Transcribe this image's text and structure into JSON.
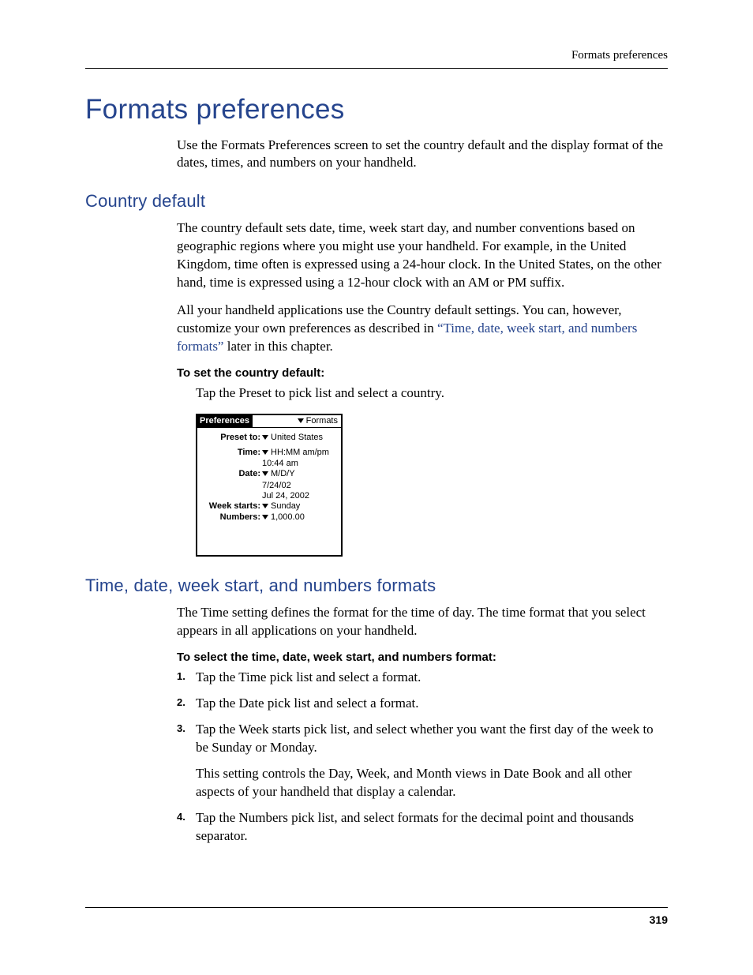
{
  "header": {
    "running": "Formats preferences"
  },
  "section": {
    "h1": "Formats preferences",
    "intro": "Use the Formats Preferences screen to set the country default and the display format of the dates, times, and numbers on your handheld."
  },
  "country": {
    "h2": "Country default",
    "p1": "The country default sets date, time, week start day, and number conventions based on geographic regions where you might use your handheld. For example, in the United Kingdom, time often is expressed using a 24-hour clock. In the United States, on the other hand, time is expressed using a 12-hour clock with an AM or PM suffix.",
    "p2_a": "All your handheld applications use the Country default settings. You can, however, customize your own preferences as described in ",
    "p2_link": "“Time, date, week start, and numbers formats”",
    "p2_b": " later in this chapter.",
    "task_heading": "To set the country default:",
    "task_step": "Tap the Preset to pick list and select a country."
  },
  "palm": {
    "title_tab": "Preferences",
    "title_menu": "Formats",
    "rows": {
      "preset_label": "Preset to:",
      "preset_value": "United States",
      "time_label": "Time:",
      "time_value": "HH:MM am/pm",
      "time_example": "10:44 am",
      "date_label": "Date:",
      "date_value": "M/D/Y",
      "date_example1": "7/24/02",
      "date_example2": "Jul 24, 2002",
      "week_label": "Week starts:",
      "week_value": "Sunday",
      "numbers_label": "Numbers:",
      "numbers_value": "1,000.00"
    }
  },
  "formats": {
    "h2": "Time, date, week start, and numbers formats",
    "intro": "The Time setting defines the format for the time of day. The time format that you select appears in all applications on your handheld.",
    "task_heading": "To select the time, date, week start, and numbers format:",
    "steps": {
      "s1_num": "1.",
      "s1": "Tap the Time pick list and select a format.",
      "s2_num": "2.",
      "s2": "Tap the Date pick list and select a format.",
      "s3_num": "3.",
      "s3": "Tap the Week starts pick list, and select whether you want the first day of the week to be Sunday or Monday.",
      "s3_note": "This setting controls the Day, Week, and Month views in Date Book and all other aspects of your handheld that display a calendar.",
      "s4_num": "4.",
      "s4": "Tap the Numbers pick list, and select formats for the decimal point and thousands separator."
    }
  },
  "footer": {
    "page": "319"
  }
}
